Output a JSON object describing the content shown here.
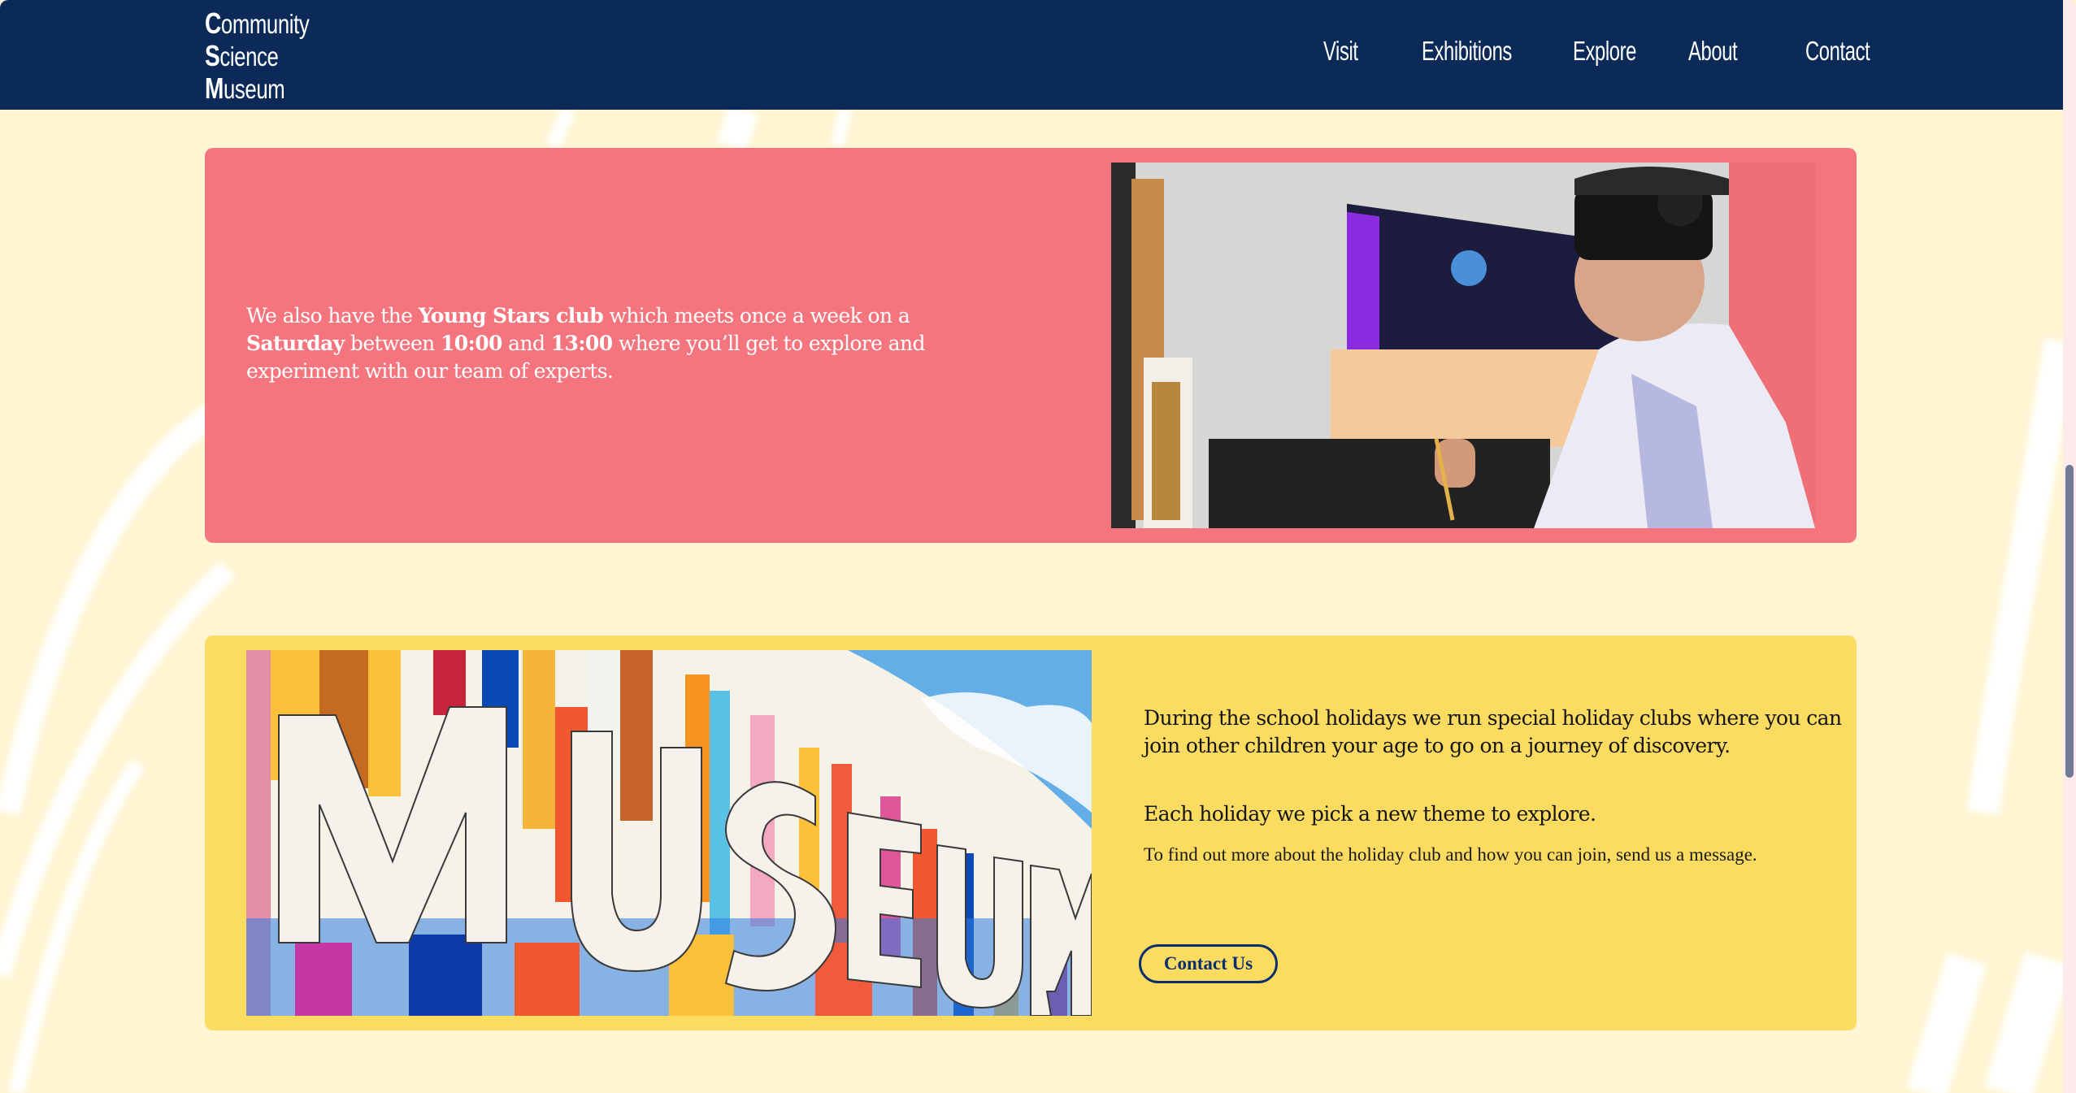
{
  "header": {
    "logo": {
      "lines": [
        {
          "cap": "C",
          "rest": "ommunity"
        },
        {
          "cap": "S",
          "rest": "cience"
        },
        {
          "cap": "M",
          "rest": "useum"
        }
      ]
    },
    "nav": [
      {
        "label": "Visit"
      },
      {
        "label": "Exhibitions"
      },
      {
        "label": "Explore"
      },
      {
        "label": "About"
      },
      {
        "label": "Contact"
      }
    ]
  },
  "young_stars": {
    "text_parts": [
      {
        "text": "We also have the ",
        "bold": false
      },
      {
        "text": "Young Stars club",
        "bold": true
      },
      {
        "text": " which meets once a week on a ",
        "bold": false
      },
      {
        "text": "Saturday",
        "bold": true
      },
      {
        "text": " between ",
        "bold": false
      },
      {
        "text": "10:00",
        "bold": true
      },
      {
        "text": " and ",
        "bold": false
      },
      {
        "text": "13:00",
        "bold": true
      },
      {
        "text": " where you’ll get to explore and experiment with our team of experts.",
        "bold": false
      }
    ],
    "image_alt": "Child wearing a VR headset painting at an easel",
    "card_color": "#f4757e"
  },
  "holiday_club": {
    "paragraph_1": "During the school holidays we run special holiday clubs where you can join other children your age to go on a journey of discovery.",
    "paragraph_2": "Each holiday we pick a new theme to explore.",
    "paragraph_3": "To find out more about the holiday club and how you can join, send us a message.",
    "button_label": "Contact Us",
    "image_alt": "Colorful museum facade with large MUSEUM letters",
    "card_color": "#fcdb61"
  },
  "colors": {
    "header_bg": "#0b2a58",
    "page_bg": "#fff5d2",
    "button_border": "#0b2f6e"
  }
}
